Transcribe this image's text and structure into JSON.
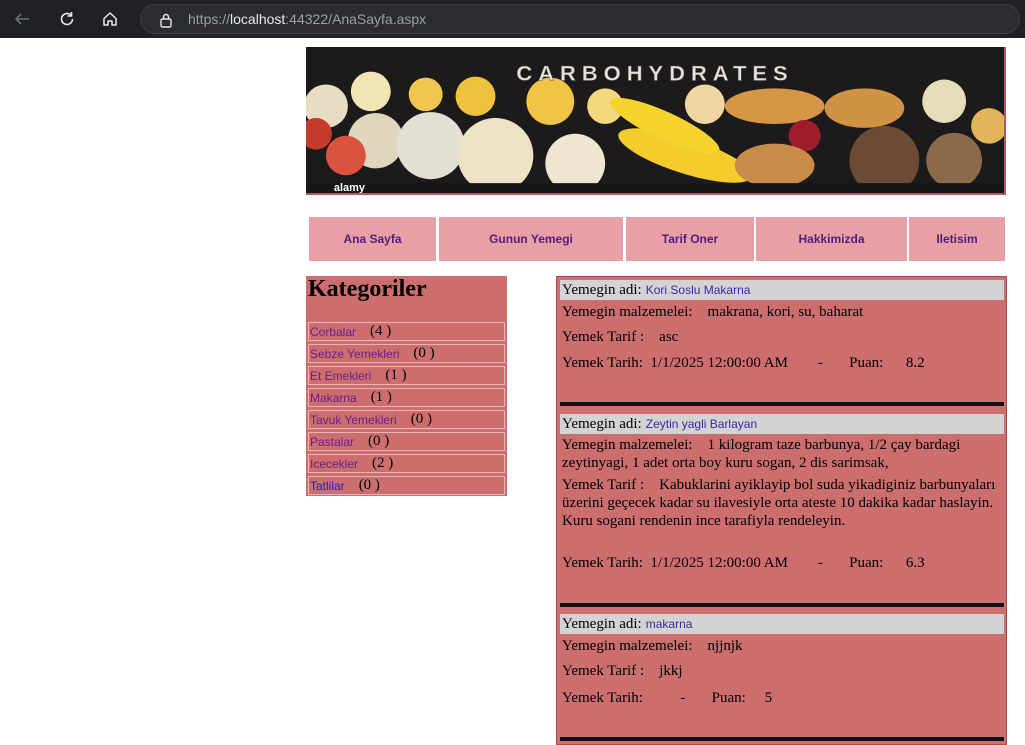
{
  "browser": {
    "url_prefix": "https://",
    "url_host": "localhost",
    "url_rest": ":44322/AnaSayfa.aspx",
    "icons": [
      "back-icon",
      "refresh-icon",
      "home-icon",
      "lock-icon"
    ]
  },
  "banner": {
    "text": "CARBOHYDRATES",
    "watermark": "alamy"
  },
  "menu": [
    {
      "label": "Ana Sayfa"
    },
    {
      "label": "Gunun Yemegi"
    },
    {
      "label": "Tarif Oner"
    },
    {
      "label": "Hakkimizda"
    },
    {
      "label": "Iletisim"
    }
  ],
  "categories": {
    "title": "Kategoriler",
    "items": [
      {
        "name": "Corbalar",
        "count": "(4 )"
      },
      {
        "name": "Sebze Yemekleri",
        "count": "(0 )"
      },
      {
        "name": "Et Emekleri",
        "count": "(1 )"
      },
      {
        "name": "Makarna",
        "count": "(1 )"
      },
      {
        "name": "Tavuk Yemekleri",
        "count": "(0 )"
      },
      {
        "name": "Pastalar",
        "count": "(0 )"
      },
      {
        "name": "Icecekler",
        "count": "(2 )"
      },
      {
        "name": "Tatlilar",
        "count": "(0 )"
      }
    ]
  },
  "labels": {
    "name": "Yemegin adi:",
    "ingredients": "Yemegin malzemelei:",
    "recipe": "Yemek Tarif :",
    "date": "Yemek Tarih:",
    "dash": "-",
    "score": "Puan:"
  },
  "recipes": [
    {
      "name": "Kori Soslu Makarna",
      "ingredients": "makrana, kori, su, baharat",
      "recipe": "asc",
      "date": "1/1/2025 12:00:00 AM",
      "score": "8.2"
    },
    {
      "name": "Zeytin yagli Barlayan",
      "ingredients": "1 kilogram taze barbunya, 1/2 çay bardagi zeytinyagi, 1 adet orta boy kuru sogan, 2 dis sarimsak,",
      "recipe": "Kabuklarini ayiklayip bol suda yikadiginiz barbunyaları üzerini geçecek kadar su ilavesiyle orta ateste 10 dakika kadar haslayin. Kuru sogani rendenin ince tarafiyla rendeleyin.",
      "date": "1/1/2025 12:00:00 AM",
      "score": "6.3"
    },
    {
      "name": "makarna",
      "ingredients": "njjnjk",
      "recipe": "jkkj",
      "date": "",
      "score": "5"
    }
  ],
  "colors": {
    "panel": "#cc6e6e",
    "menu": "#e6a0a6",
    "link": "#6a1f8c"
  }
}
